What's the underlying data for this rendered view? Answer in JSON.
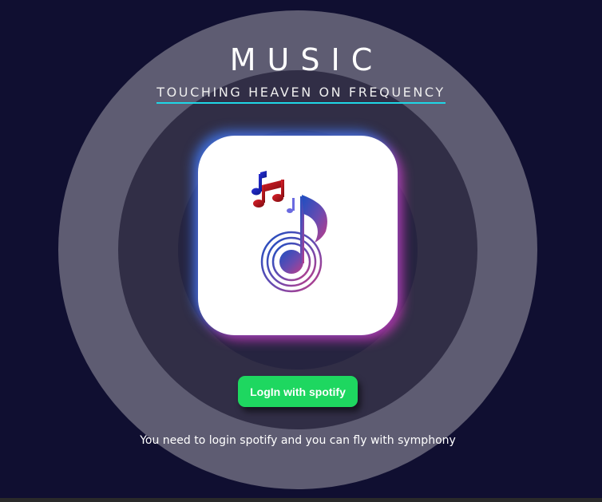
{
  "header": {
    "title": "MUSIC",
    "subtitle": "TOUCHING HEAVEN ON FREQUENCY"
  },
  "logo": {
    "icon": "music-note-icon"
  },
  "login": {
    "button_label": "LogIn with spotify"
  },
  "footer": {
    "hint": "You need to login spotify and you can fly with symphony"
  },
  "colors": {
    "background": "#100f31",
    "ring_outer": "#5e5c72",
    "ring_middle": "#312e46",
    "ring_inner": "#262440",
    "accent_underline": "#1fd7e6",
    "spotify_green": "#1ed760"
  }
}
